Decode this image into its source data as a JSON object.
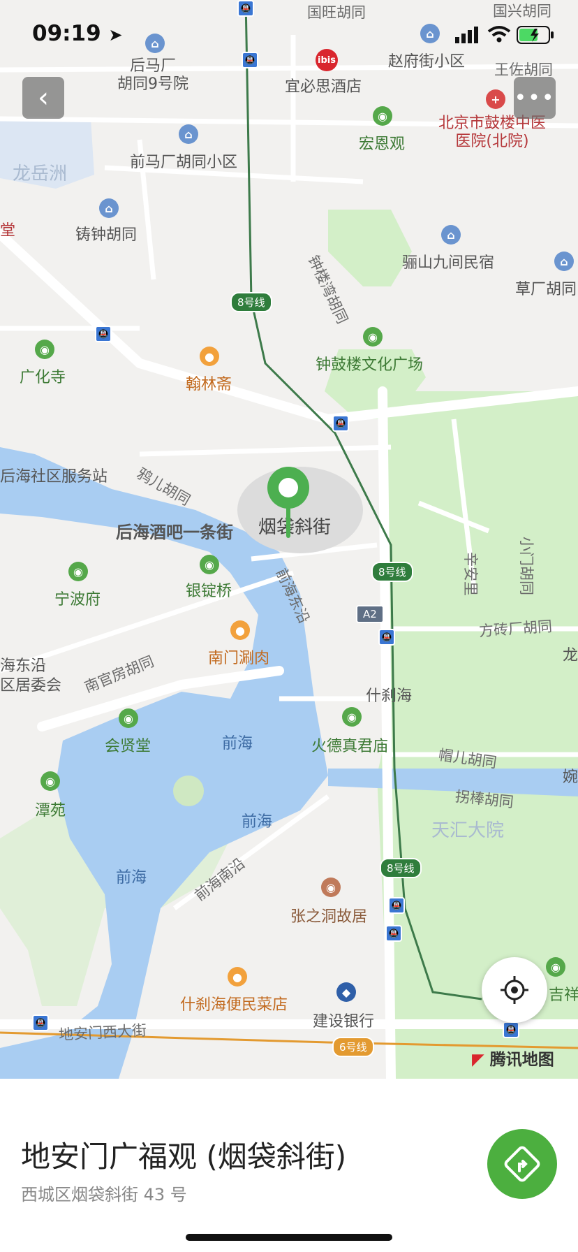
{
  "status": {
    "time": "09:19"
  },
  "map": {
    "labels": [
      {
        "text": "国旺胡同",
        "c": "road"
      },
      {
        "text": "国兴胡同",
        "c": "road"
      },
      {
        "text": "后马厂\n胡同9号院",
        "c": ""
      },
      {
        "text": "宜必思酒店",
        "c": ""
      },
      {
        "text": "赵府街小区",
        "c": ""
      },
      {
        "text": "王佐胡同",
        "c": "road"
      },
      {
        "text": "宏恩观",
        "c": "green"
      },
      {
        "text": "北京市鼓楼中医\n医院(北院)",
        "c": "red"
      },
      {
        "text": "前马厂胡同小区",
        "c": ""
      },
      {
        "text": "龙岳洲",
        "c": "faint"
      },
      {
        "text": "铸钟胡同",
        "c": ""
      },
      {
        "text": "钟楼湾胡同",
        "c": "road"
      },
      {
        "text": "骊山九间民宿",
        "c": ""
      },
      {
        "text": "草厂胡同",
        "c": ""
      },
      {
        "text": "广化寺",
        "c": "green"
      },
      {
        "text": "翰林斋",
        "c": "orange"
      },
      {
        "text": "钟鼓楼文化广场",
        "c": "green"
      },
      {
        "text": "后海社区服务站",
        "c": ""
      },
      {
        "text": "鸦儿胡同",
        "c": "road"
      },
      {
        "text": "后海酒吧一条街",
        "c": "bold"
      },
      {
        "text": "烟袋斜街",
        "c": "big"
      },
      {
        "text": "辛安里",
        "c": "road"
      },
      {
        "text": "小门胡同",
        "c": "road"
      },
      {
        "text": "宁波府",
        "c": "green"
      },
      {
        "text": "银锭桥",
        "c": "green"
      },
      {
        "text": "前海东沿",
        "c": "road"
      },
      {
        "text": "方砖厂胡同",
        "c": "road"
      },
      {
        "text": "南门涮肉",
        "c": "orange"
      },
      {
        "text": "海东沿\n区居委会",
        "c": ""
      },
      {
        "text": "南官房胡同",
        "c": "road"
      },
      {
        "text": "什刹海",
        "c": ""
      },
      {
        "text": "会贤堂",
        "c": "green"
      },
      {
        "text": "前海",
        "c": "water"
      },
      {
        "text": "火德真君庙",
        "c": "green"
      },
      {
        "text": "帽儿胡同",
        "c": "road"
      },
      {
        "text": "潭苑",
        "c": "green"
      },
      {
        "text": "前海",
        "c": "water"
      },
      {
        "text": "拐棒胡同",
        "c": "road"
      },
      {
        "text": "天汇大院",
        "c": "faint"
      },
      {
        "text": "前海",
        "c": "water"
      },
      {
        "text": "前海南沿",
        "c": "road"
      },
      {
        "text": "张之洞故居",
        "c": "brown"
      },
      {
        "text": "什刹海便民菜店",
        "c": "orange"
      },
      {
        "text": "建设银行",
        "c": ""
      },
      {
        "text": "地安门西大街",
        "c": "road"
      },
      {
        "text": "吉祥",
        "c": "green"
      },
      {
        "text": "婉",
        "c": ""
      },
      {
        "text": "龙",
        "c": ""
      },
      {
        "text": "堂",
        "c": "red"
      }
    ],
    "line_tags": [
      "8号线",
      "8号线",
      "8号线",
      "6号线"
    ],
    "ibis": "ibis",
    "road_badge": "A2",
    "brand": "腾讯地图"
  },
  "place": {
    "name": "地安门广福观 (烟袋斜街)",
    "address": "西城区烟袋斜街 43 号"
  }
}
